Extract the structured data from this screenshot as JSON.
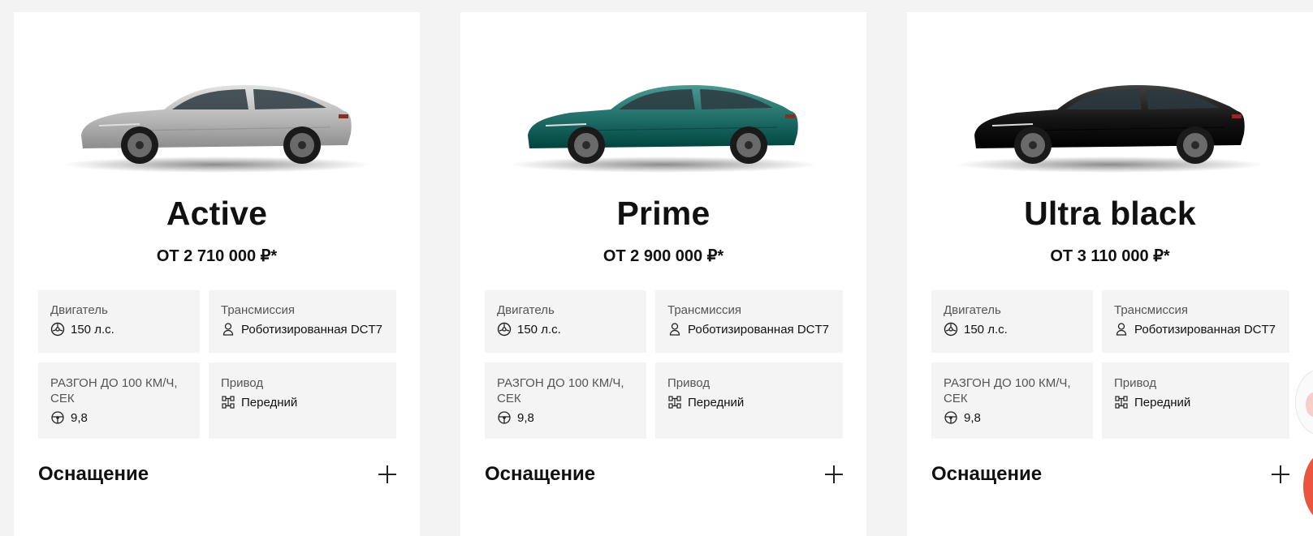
{
  "colors": {
    "page_bg": "#f3f3f3",
    "card_bg": "#ffffff",
    "spec_bg": "#f4f4f4",
    "accent_red": "#e9553d",
    "car_colors": [
      "#b5b5b5",
      "#1f6b66",
      "#141414"
    ]
  },
  "cards": [
    {
      "car_image": "silver-sedan-image",
      "name": "Active",
      "price": "ОТ 2 710 000 ₽*",
      "specs": {
        "engine_label": "Двигатель",
        "engine_value": "150 л.с.",
        "engine_icon": "engine-icon",
        "transmission_label": "Трансмиссия",
        "transmission_value": "Роботизированная DCT7",
        "transmission_icon": "gearbox-icon",
        "accel_label": "РАЗГОН ДО 100 КМ/Ч, СЕК",
        "accel_value": "9,8",
        "accel_icon": "steering-wheel-icon",
        "drive_label": "Привод",
        "drive_value": "Передний",
        "drive_icon": "drivetrain-icon"
      },
      "equipment_label": "Оснащение"
    },
    {
      "car_image": "teal-sedan-image",
      "name": "Prime",
      "price": "ОТ 2 900 000 ₽*",
      "specs": {
        "engine_label": "Двигатель",
        "engine_value": "150 л.с.",
        "engine_icon": "engine-icon",
        "transmission_label": "Трансмиссия",
        "transmission_value": "Роботизированная DCT7",
        "transmission_icon": "gearbox-icon",
        "accel_label": "РАЗГОН ДО 100 КМ/Ч, СЕК",
        "accel_value": "9,8",
        "accel_icon": "steering-wheel-icon",
        "drive_label": "Привод",
        "drive_value": "Передний",
        "drive_icon": "drivetrain-icon"
      },
      "equipment_label": "Оснащение"
    },
    {
      "car_image": "black-sedan-image",
      "name": "Ultra black",
      "price": "ОТ 3 110 000 ₽*",
      "specs": {
        "engine_label": "Двигатель",
        "engine_value": "150 л.с.",
        "engine_icon": "engine-icon",
        "transmission_label": "Трансмиссия",
        "transmission_value": "Роботизированная DCT7",
        "transmission_icon": "gearbox-icon",
        "accel_label": "РАЗГОН ДО 100 КМ/Ч, СЕК",
        "accel_value": "9,8",
        "accel_icon": "steering-wheel-icon",
        "drive_label": "Привод",
        "drive_value": "Передний",
        "drive_icon": "drivetrain-icon"
      },
      "equipment_label": "Оснащение"
    }
  ]
}
